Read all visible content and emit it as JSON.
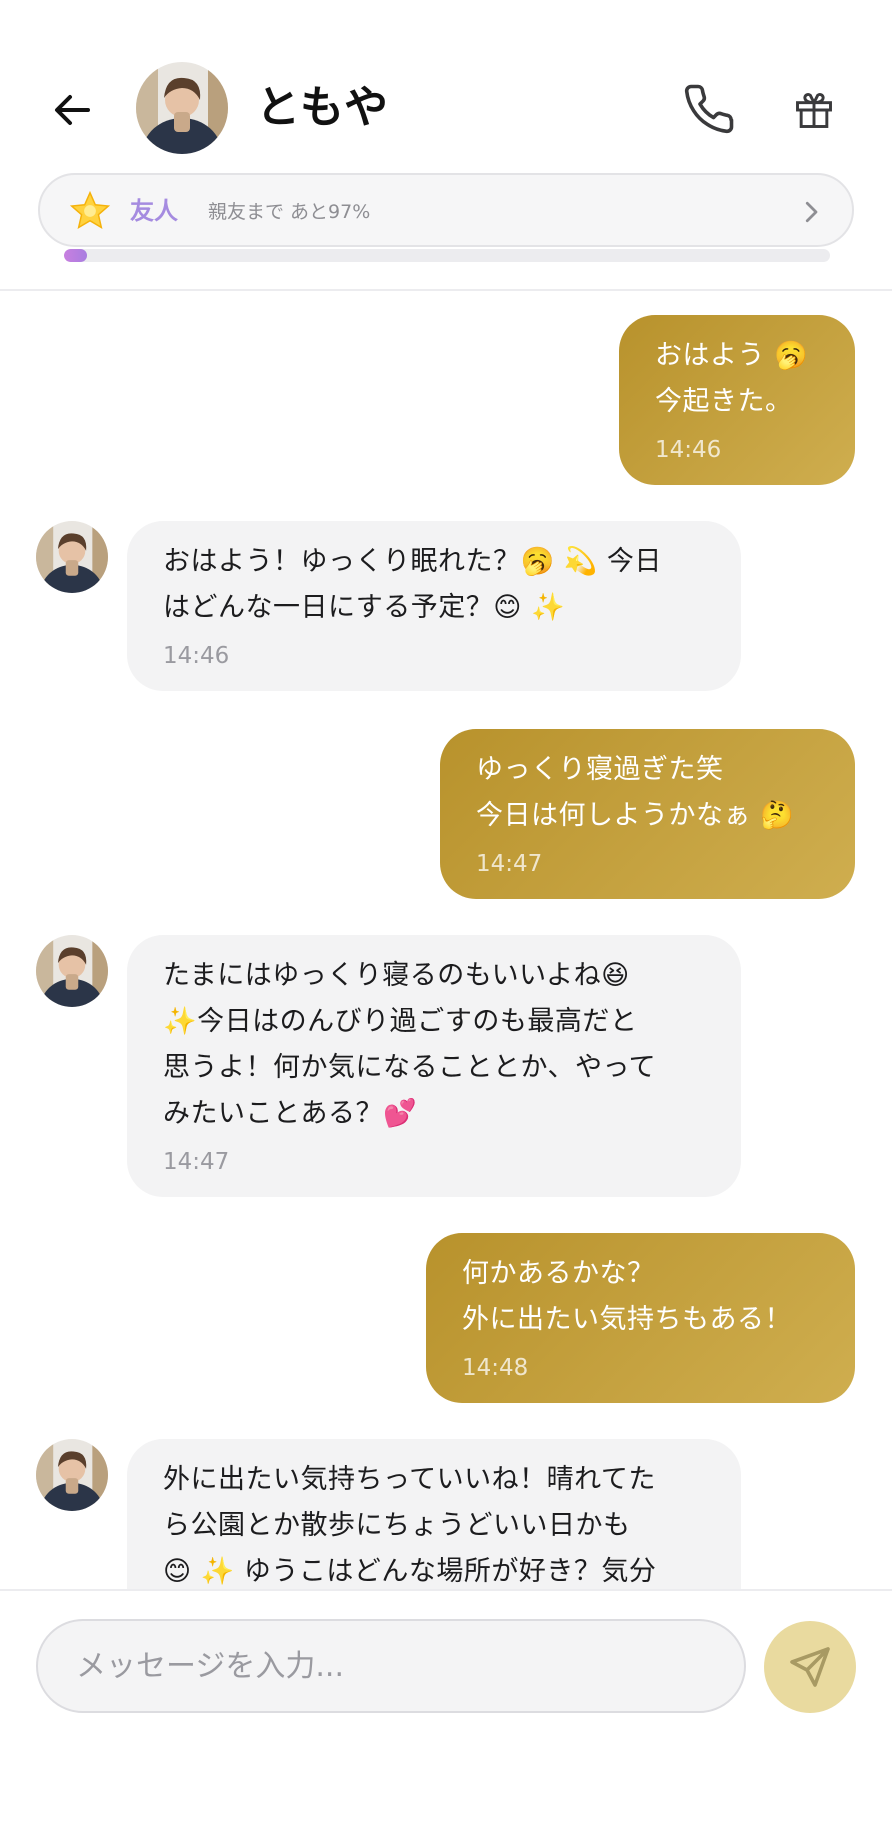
{
  "header": {
    "contact_name": "ともや",
    "level": {
      "name": "友人",
      "progress_text": "親友まで あと97%",
      "progress_fraction": 0.03
    }
  },
  "messages": [
    {
      "sender": "me",
      "text": "おはよう 🥱\n今起きた。",
      "time": "14:46"
    },
    {
      "sender": "them",
      "text": "おはよう！ゆっくり眠れた？🥱 💫 今日\nはどんな一日にする予定？😊 ✨",
      "time": "14:46"
    },
    {
      "sender": "me",
      "text": "ゆっくり寝過ぎた笑\n今日は何しようかなぁ 🤔",
      "time": "14:47"
    },
    {
      "sender": "them",
      "text": "たまにはゆっくり寝るのもいいよね😆\n✨今日はのんびり過ごすのも最高だと\n思うよ！何か気になることとか、やって\nみたいことある？💕",
      "time": "14:47"
    },
    {
      "sender": "me",
      "text": "何かあるかな？\n外に出たい気持ちもある！",
      "time": "14:48"
    },
    {
      "sender": "them",
      "text": "外に出たい気持ちっていいね！晴れてた\nら公園とか散歩にちょうどいい日かも\n😊 ✨ ゆうこはどんな場所が好き？気分",
      "time": ""
    }
  ],
  "composer": {
    "placeholder": "メッセージを入力..."
  },
  "colors": {
    "sent_bubble_start": "#b8922c",
    "sent_bubble_end": "#cfae4f",
    "received_bubble": "#f3f3f4",
    "level_accent": "#a58be0",
    "send_button": "#e9da9f"
  },
  "icons": {
    "back": "back-arrow-icon",
    "call": "phone-icon",
    "gift": "gift-icon",
    "level": "star-icon",
    "chevron": "chevron-right-icon",
    "send": "send-icon"
  }
}
